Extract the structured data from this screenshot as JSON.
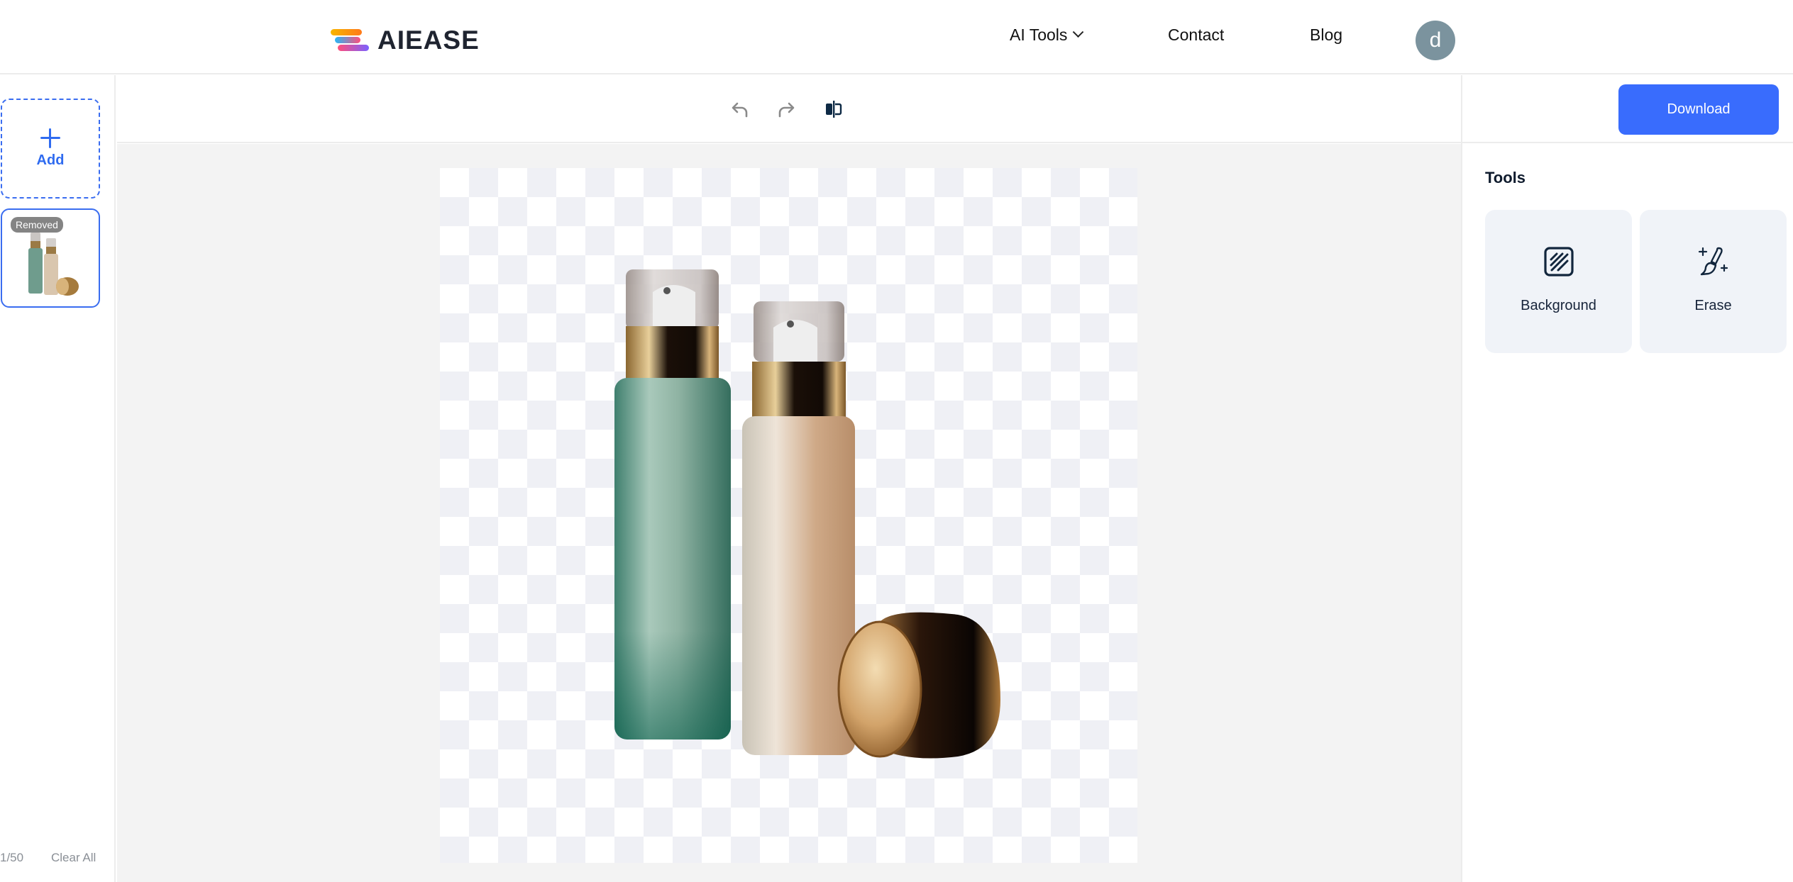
{
  "header": {
    "brand": "AIEASE",
    "nav": [
      {
        "label": "AI Tools",
        "has_dropdown": true
      },
      {
        "label": "Contact"
      },
      {
        "label": "Blog"
      }
    ],
    "avatar_initial": "d",
    "avatar_color": "#7b939e"
  },
  "sidebar": {
    "add_label": "Add",
    "items": [
      {
        "badge": "Removed",
        "selected": true
      }
    ],
    "count": "1/50",
    "clear_label": "Clear All"
  },
  "toolbar": {
    "undo": "undo-icon",
    "redo": "redo-icon",
    "compare": "compare-icon"
  },
  "canvas": {
    "background": "transparent-checkerboard",
    "subject": "two cosmetic pump bottles (green and beige) with gold cap"
  },
  "right_panel": {
    "download_label": "Download",
    "tools_title": "Tools",
    "tools": [
      {
        "label": "Background",
        "icon": "background-pattern-icon"
      },
      {
        "label": "Erase",
        "icon": "magic-brush-icon"
      }
    ]
  },
  "colors": {
    "accent": "#396cfd",
    "text": "#0f1b2d",
    "muted": "#8a8f96",
    "card_bg": "#f0f3f8"
  }
}
